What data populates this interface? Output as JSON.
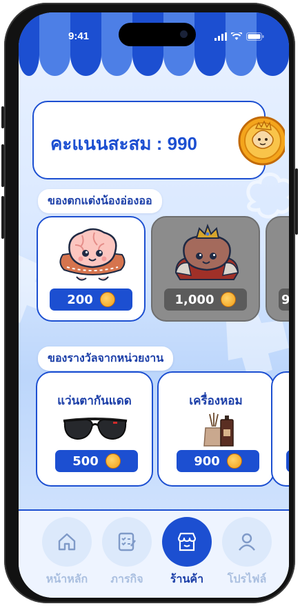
{
  "status_bar": {
    "time": "9:41"
  },
  "points": {
    "label": "คะแนนสะสม : 990"
  },
  "sections": {
    "decorations_title": "ของตกแต่งน้องอ่องออ",
    "rewards_title": "ของรางวัลจากหน่วยงาน"
  },
  "decorations": [
    {
      "price": "200",
      "state": "available"
    },
    {
      "price": "1,000",
      "state": "locked"
    },
    {
      "price": "9",
      "state": "partial"
    }
  ],
  "rewards": [
    {
      "name": "แว่นตากันแดด",
      "price": "500",
      "icon": "sunglasses-icon"
    },
    {
      "name": "เครื่องหอม",
      "price": "900",
      "icon": "diffuser-icon"
    }
  ],
  "nav": [
    {
      "label": "หน้าหลัก",
      "icon": "home-icon",
      "active": false
    },
    {
      "label": "ภารกิจ",
      "icon": "checklist-icon",
      "active": false
    },
    {
      "label": "ร้านค้า",
      "icon": "store-icon",
      "active": true
    },
    {
      "label": "โปรไฟล์",
      "icon": "profile-icon",
      "active": false
    }
  ],
  "colors": {
    "primary": "#1C4FD1",
    "coin": "#F29E16",
    "background": "#D9E8FF"
  }
}
